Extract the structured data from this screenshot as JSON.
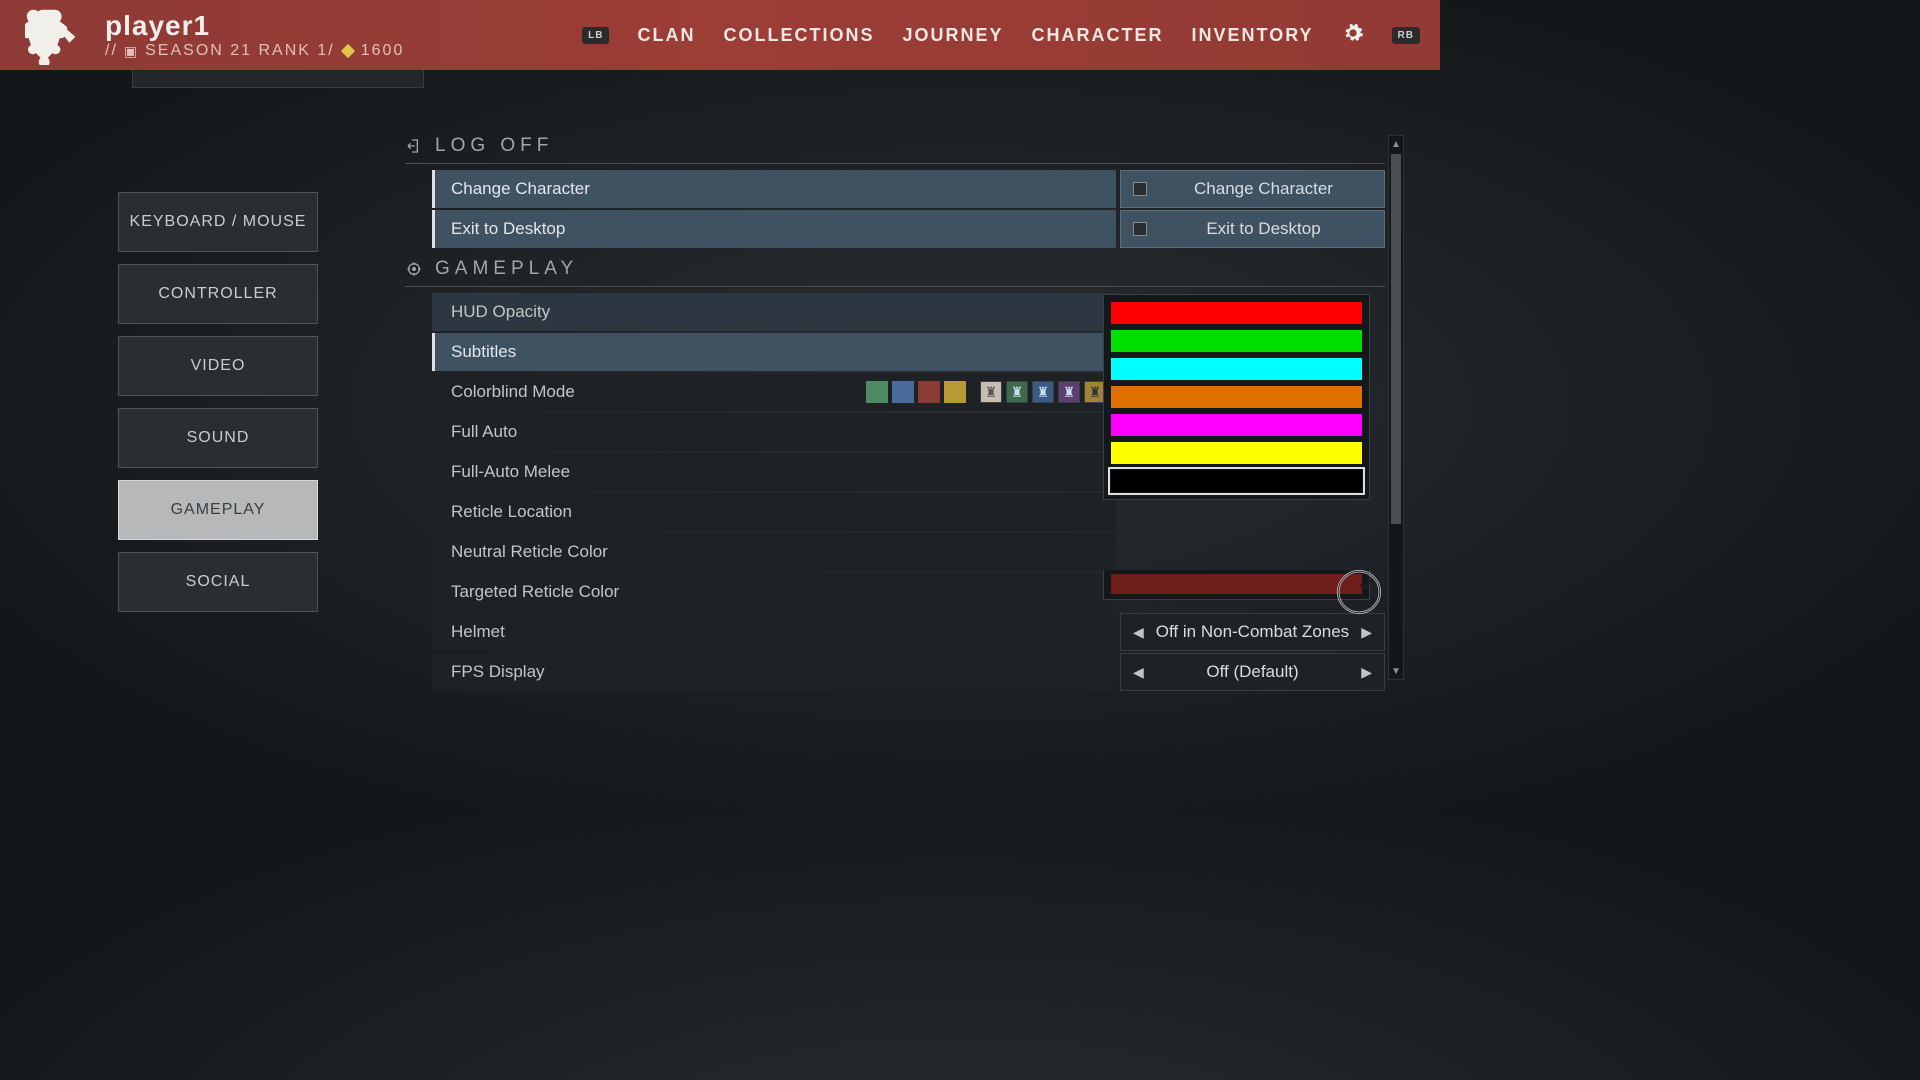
{
  "header": {
    "player_name": "player1",
    "season_prefix": "// ",
    "season_text": "SEASON 21 RANK 1/",
    "power": "1600",
    "nav": {
      "lb": "LB",
      "clan": "CLAN",
      "collections": "COLLECTIONS",
      "journey": "JOURNEY",
      "character": "CHARACTER",
      "inventory": "INVENTORY",
      "rb": "RB"
    }
  },
  "sidebar": {
    "items": [
      "KEYBOARD / MOUSE",
      "CONTROLLER",
      "VIDEO",
      "SOUND",
      "GAMEPLAY",
      "SOCIAL"
    ],
    "active_index": 4
  },
  "sections": {
    "logoff": {
      "title": "LOG OFF",
      "rows": [
        {
          "label": "Change Character",
          "right": "Change Character"
        },
        {
          "label": "Exit to Desktop",
          "right": "Exit to Desktop"
        }
      ]
    },
    "gameplay": {
      "title": "GAMEPLAY",
      "rows": {
        "hud_opacity": "HUD Opacity",
        "subtitles": "Subtitles",
        "colorblind": "Colorblind Mode",
        "full_auto": "Full Auto",
        "full_auto_melee": "Full-Auto Melee",
        "reticle_location": "Reticle Location",
        "neutral_reticle": "Neutral Reticle Color",
        "targeted_reticle": "Targeted Reticle Color",
        "helmet": "Helmet",
        "helmet_value": "Off in Non-Combat Zones",
        "fps": "FPS Display",
        "fps_value": "Off (Default)"
      }
    }
  },
  "colorblind_swatches": [
    "#4e8a62",
    "#4a6b9c",
    "#8a3c34",
    "#b89b34"
  ],
  "colorblind_icon_bgs": [
    "#c6beb2",
    "#3e6b4e",
    "#3a5c84",
    "#5c3f73",
    "#a08432"
  ],
  "color_panel": {
    "colors": [
      "#ff0000",
      "#00e000",
      "#00ffff",
      "#e07000",
      "#ff00ff",
      "#ffff00",
      "#000000"
    ],
    "selected_index": 6,
    "extra_bottom": "#6e1f1c"
  }
}
